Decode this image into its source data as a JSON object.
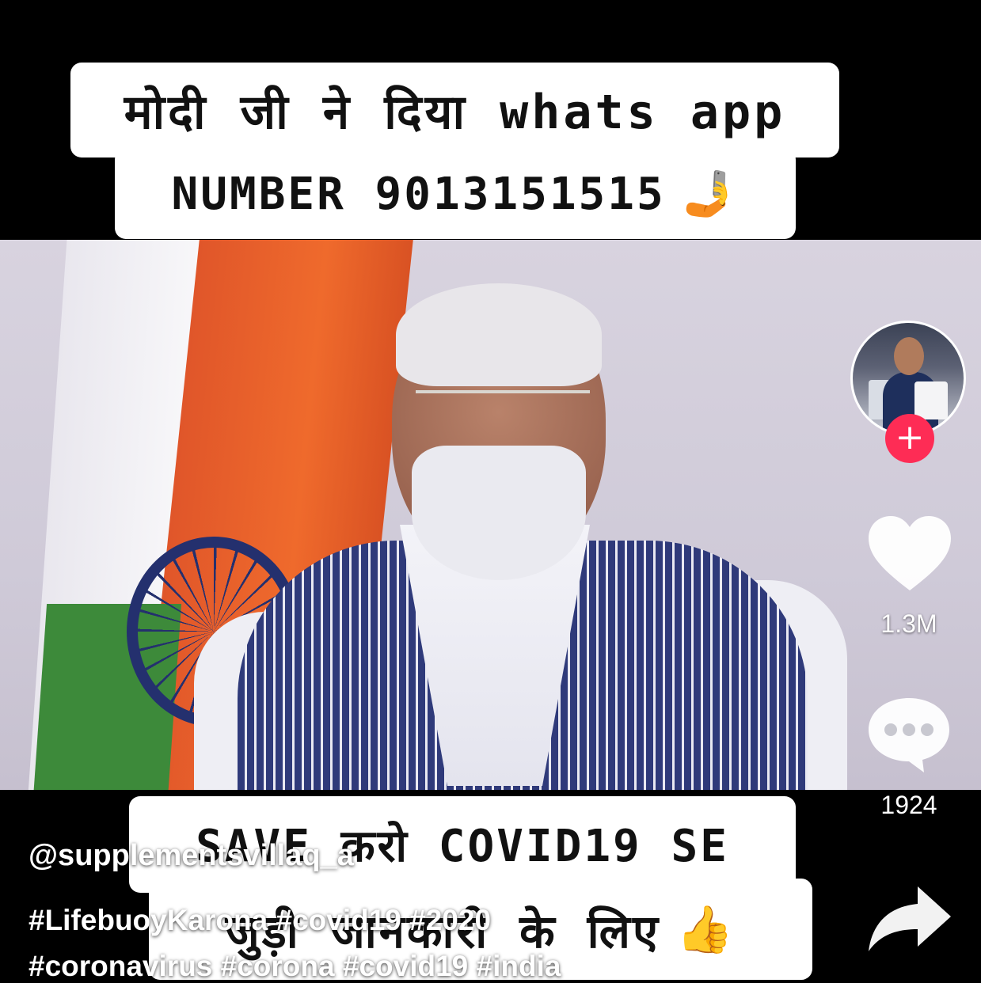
{
  "overlay": {
    "top_line1": "मोदी जी ने दिया whats app",
    "top_line2": "NUMBER 9013151515",
    "top_line2_emoji": "🤳",
    "bottom_line1": "SAVE करो COVID19 SE",
    "bottom_line2": "जुड़ी जानकारी के लिए",
    "bottom_line2_emoji": "👍"
  },
  "rail": {
    "follow_symbol": "+",
    "likes": "1.3M",
    "comments": "1924",
    "icons": [
      "avatar",
      "follow-plus-icon",
      "heart-icon",
      "comment-icon",
      "share-icon"
    ]
  },
  "post": {
    "username": "@supplementsvillaq_a",
    "caption_line1": "#LifebuoyKarona #covid19 #2020",
    "caption_line2": "#coronavirus #corona #covid19 #india"
  },
  "colors": {
    "follow_accent": "#fe2c55",
    "caption_bg": "#ffffff",
    "background": "#000000"
  }
}
